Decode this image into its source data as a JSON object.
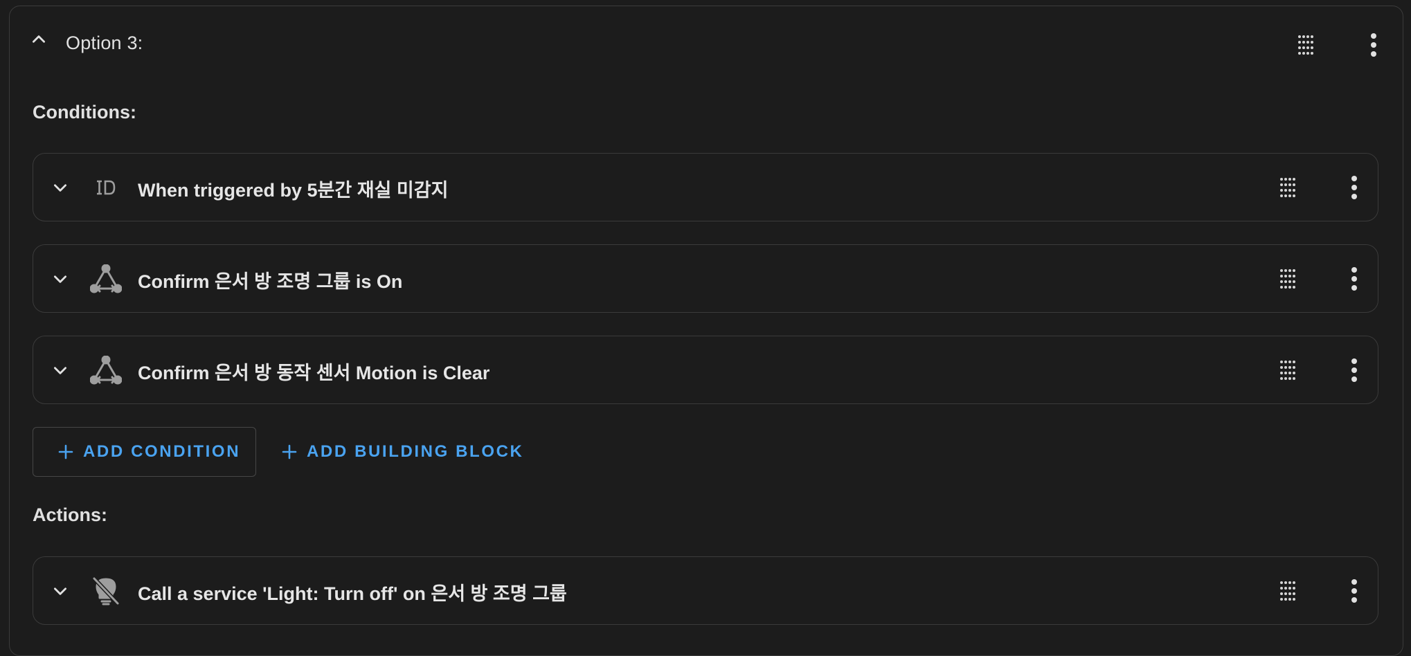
{
  "option": {
    "title": "Option 3:"
  },
  "conditions": {
    "heading": "Conditions:",
    "items": [
      {
        "label": "When triggered by 5분간 재실 미감지",
        "icon": "trigger-id-icon"
      },
      {
        "label": "Confirm 은서 방 조명 그룹 is On",
        "icon": "state-condition-icon"
      },
      {
        "label": "Confirm 은서 방 동작 센서 Motion is Clear",
        "icon": "state-condition-icon"
      }
    ],
    "add_condition_label": "ADD CONDITION",
    "add_building_block_label": "ADD BUILDING BLOCK"
  },
  "actions": {
    "heading": "Actions:",
    "items": [
      {
        "label": "Call a service 'Light: Turn off' on 은서 방 조명 그룹",
        "icon": "light-off-icon"
      }
    ]
  },
  "colors": {
    "background": "#1c1c1c",
    "border": "#3b3b3b",
    "accent": "#4aa3f0",
    "text": "#e1e1e1",
    "icon": "#9e9e9e"
  }
}
